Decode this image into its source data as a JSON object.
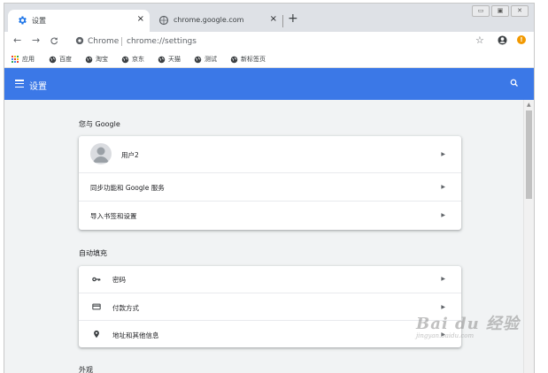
{
  "tabs": [
    {
      "title": "设置",
      "icon": "gear-icon",
      "active": true
    },
    {
      "title": "chrome.google.com",
      "icon": "globe-icon",
      "active": false
    }
  ],
  "tab_close_glyph": "×",
  "new_tab_glyph": "+",
  "window_controls": [
    "▭",
    "▣",
    "✕"
  ],
  "omnibox": {
    "host": "Chrome",
    "url": "chrome://settings"
  },
  "bookmarks": [
    {
      "label": "应用",
      "icon": "apps-grid-icon"
    },
    {
      "label": "百度",
      "icon": "globe-icon"
    },
    {
      "label": "淘宝",
      "icon": "globe-icon"
    },
    {
      "label": "京东",
      "icon": "globe-icon"
    },
    {
      "label": "天猫",
      "icon": "globe-icon"
    },
    {
      "label": "测试",
      "icon": "globe-icon"
    },
    {
      "label": "新标签页",
      "icon": "globe-icon"
    }
  ],
  "header": {
    "title": "设置"
  },
  "sections": [
    {
      "title": "您与 Google",
      "rows": [
        {
          "label": "用户2",
          "icon": "avatar-icon"
        },
        {
          "label": "同步功能和 Google 服务"
        },
        {
          "label": "导入书签和设置"
        }
      ]
    },
    {
      "title": "自动填充",
      "rows": [
        {
          "label": "密码",
          "icon": "key-icon"
        },
        {
          "label": "付款方式",
          "icon": "credit-card-icon"
        },
        {
          "label": "地址和其他信息",
          "icon": "location-pin-icon"
        }
      ]
    },
    {
      "title": "外观",
      "rows": []
    }
  ],
  "chevron_glyph": "▶",
  "colors": {
    "header": "#3b78e7",
    "content_bg": "#f1f3f4",
    "tabstrip_bg": "#dee1e6",
    "alert": "#f29900"
  },
  "watermark": {
    "logo": "Bai du 经验",
    "url": "jingyan.baidu.com"
  }
}
